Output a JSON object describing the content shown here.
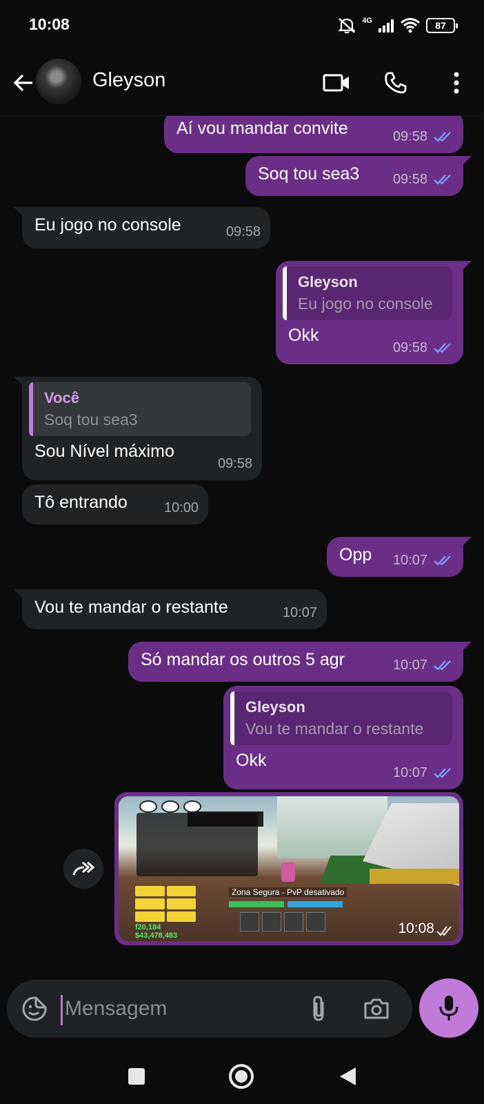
{
  "status_bar": {
    "time": "10:08",
    "network": "4G",
    "battery": "87"
  },
  "header": {
    "contact_name": "Gleyson",
    "icons": [
      "back-arrow-icon",
      "video-call-icon",
      "phone-icon",
      "more-vert-icon"
    ]
  },
  "messages": [
    {
      "direction": "out",
      "text": "Aí vou mandar convite",
      "time": "09:58",
      "status": "read"
    },
    {
      "direction": "out",
      "text": "Soq tou sea3",
      "time": "09:58",
      "status": "read"
    },
    {
      "direction": "in",
      "text": "Eu jogo no console",
      "time": "09:58"
    },
    {
      "direction": "out",
      "quote": {
        "name": "Gleyson",
        "text": "Eu jogo no console"
      },
      "text": "Okk",
      "time": "09:58",
      "status": "read"
    },
    {
      "direction": "in",
      "quote": {
        "name": "Você",
        "text": "Soq tou sea3"
      },
      "text": "Sou Nível máximo",
      "time": "09:58"
    },
    {
      "direction": "in",
      "text": "Tô entrando",
      "time": "10:00"
    },
    {
      "direction": "out",
      "text": "Opp",
      "time": "10:07",
      "status": "read"
    },
    {
      "direction": "in",
      "text": "Vou te mandar o restante",
      "time": "10:07"
    },
    {
      "direction": "out",
      "text": "Só mandar os outros 5 agr",
      "time": "10:07",
      "status": "read"
    },
    {
      "direction": "out",
      "quote": {
        "name": "Gleyson",
        "text": "Vou te mandar o restante"
      },
      "text": "Okk",
      "time": "10:07",
      "status": "read"
    },
    {
      "direction": "out",
      "type": "image",
      "time": "10:08",
      "status": "sent"
    }
  ],
  "image_message": {
    "game_texts": {
      "safe_zone": "Zona Segura - PvP desativado",
      "money_1": "f20,184",
      "money_2": "$43,478,483"
    }
  },
  "composer": {
    "placeholder": "Mensagem",
    "value": ""
  },
  "colors": {
    "outgoing_bubble": "#6b2e87",
    "incoming_bubble": "#1f2326",
    "accent": "#c07ad8",
    "read_ticks": "#7aa6ff",
    "background": "#0b0b0c"
  }
}
